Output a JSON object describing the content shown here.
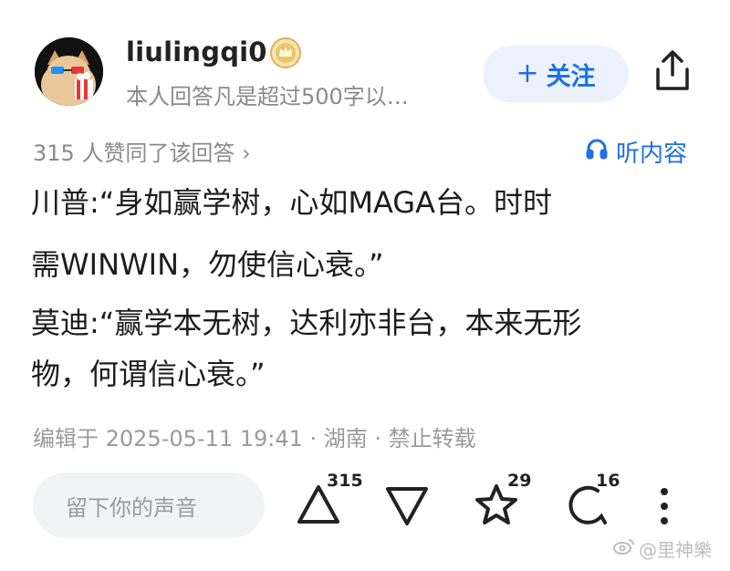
{
  "header": {
    "username": "liulingqi0",
    "bio": "本人回答凡是超过500字以…",
    "follow_label": "关注",
    "follow_plus": "+"
  },
  "meta": {
    "likes_line": "315 人赞同了该回答 ›",
    "listen_label": "听内容"
  },
  "body": {
    "line1": "川普:“身如赢学树，心如MAGA台。时时",
    "line2": "需WINWIN，勿使信心衰。”",
    "line3": "莫迪:“赢学本无树，达利亦非台，本来无形",
    "line4": "物，何谓信心衰。”"
  },
  "edit_line": "编辑于 2025-05-11 19:41 · 湖南 · 禁止转载",
  "actions": {
    "comment_placeholder": "留下你的声音",
    "upvote_count": "315",
    "favorite_count": "29",
    "comment_count": "16"
  },
  "watermark": "@里神樂",
  "colors": {
    "accent": "#1f6fe5",
    "follow_bg": "#ebf2fd",
    "muted": "#8a8a8a"
  },
  "icons": [
    "avatar-dog-popcorn",
    "crown-badge-icon",
    "share-icon",
    "headphones-icon",
    "upvote-icon",
    "downvote-icon",
    "star-icon",
    "comment-icon",
    "more-icon",
    "weibo-icon"
  ]
}
